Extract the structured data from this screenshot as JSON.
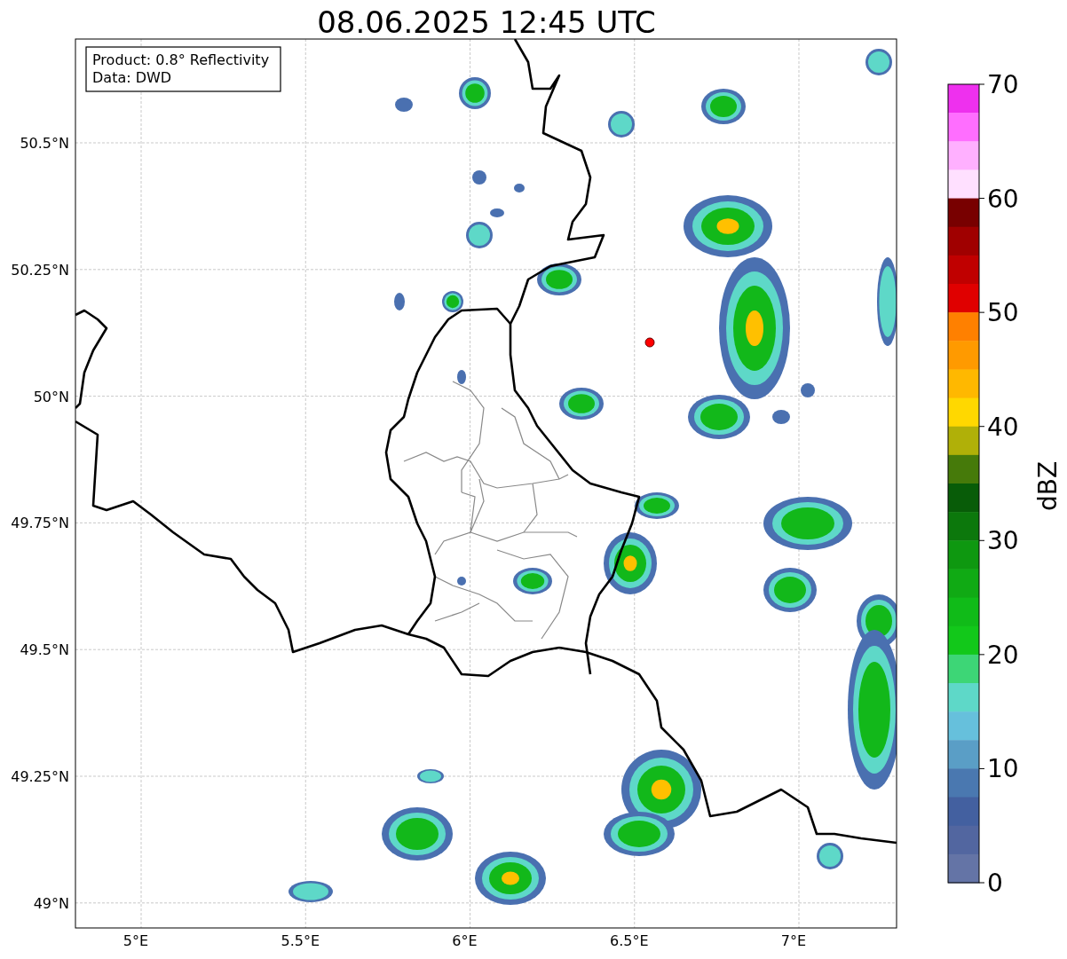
{
  "title": "08.06.2025 12:45 UTC",
  "info_box": [
    "Product: 0.8° Reflectivity",
    "Data: DWD"
  ],
  "y_ticks": [
    "50.5°N",
    "50.25°N",
    "50°N",
    "49.75°N",
    "49.5°N",
    "49.25°N",
    "49°N"
  ],
  "x_ticks": [
    "5°E",
    "5.5°E",
    "6°E",
    "6.5°E",
    "7°E"
  ],
  "colorbar": {
    "label": "dBZ",
    "ticks": [
      "70",
      "60",
      "50",
      "40",
      "30",
      "20",
      "10",
      "0"
    ],
    "bands": [
      {
        "color": "#ee30ee"
      },
      {
        "color": "#ff6eff"
      },
      {
        "color": "#ffb0ff"
      },
      {
        "color": "#ffe0ff"
      },
      {
        "color": "#780000"
      },
      {
        "color": "#a00000"
      },
      {
        "color": "#c00000"
      },
      {
        "color": "#e00000"
      },
      {
        "color": "#ff8000"
      },
      {
        "color": "#ff9a00"
      },
      {
        "color": "#ffb800"
      },
      {
        "color": "#ffd800"
      },
      {
        "color": "#b0b008"
      },
      {
        "color": "#467a0a"
      },
      {
        "color": "#085c08"
      },
      {
        "color": "#0c780c"
      },
      {
        "color": "#0e9810"
      },
      {
        "color": "#10aa14"
      },
      {
        "color": "#10bb18"
      },
      {
        "color": "#12c81a"
      },
      {
        "color": "#3dd676"
      },
      {
        "color": "#5ed8c8"
      },
      {
        "color": "#66c0dc"
      },
      {
        "color": "#5a9ec6"
      },
      {
        "color": "#4a78b0"
      },
      {
        "color": "#4360a0"
      },
      {
        "color": "#5266a0"
      },
      {
        "color": "#6474a6"
      }
    ]
  }
}
